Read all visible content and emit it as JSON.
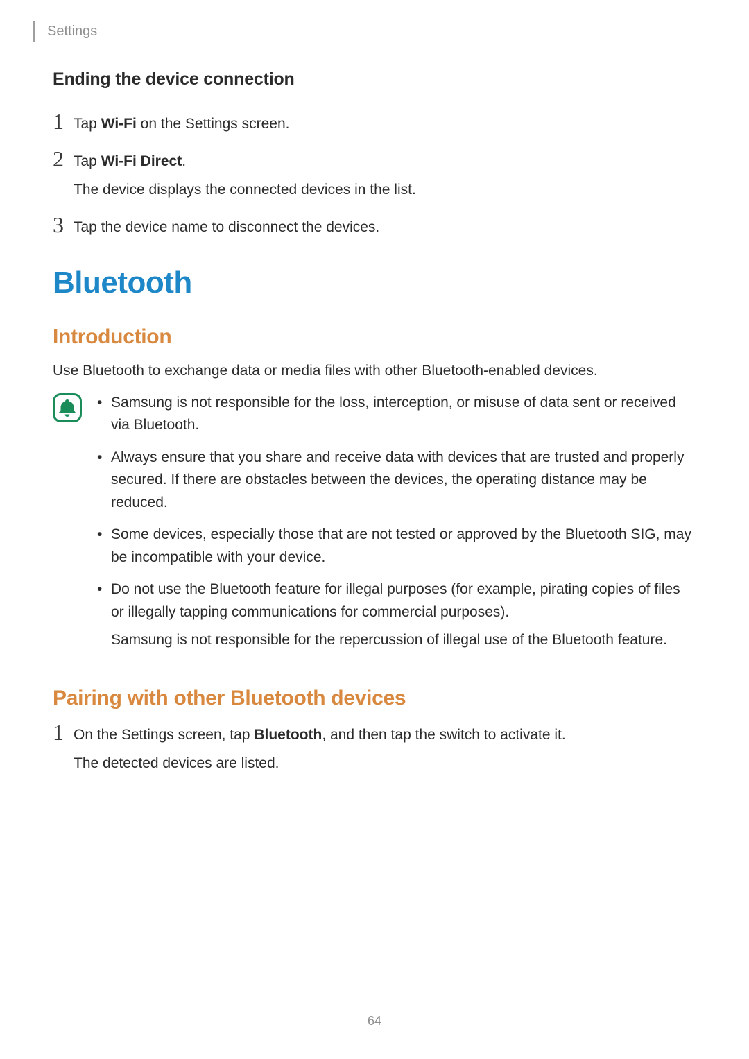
{
  "header": {
    "section": "Settings"
  },
  "sec1": {
    "heading": "Ending the device connection",
    "steps": [
      {
        "num": "1",
        "pre": "Tap ",
        "bold": "Wi-Fi",
        "post": " on the Settings screen."
      },
      {
        "num": "2",
        "pre": "Tap ",
        "bold": "Wi-Fi Direct",
        "post": ".",
        "sub": "The device displays the connected devices in the list."
      },
      {
        "num": "3",
        "pre": "Tap the device name to disconnect the devices.",
        "bold": "",
        "post": ""
      }
    ]
  },
  "sec2": {
    "title": "Bluetooth",
    "intro_h": "Introduction",
    "intro_p": "Use Bluetooth to exchange data or media files with other Bluetooth-enabled devices.",
    "notes": [
      {
        "text": "Samsung is not responsible for the loss, interception, or misuse of data sent or received via Bluetooth."
      },
      {
        "text": "Always ensure that you share and receive data with devices that are trusted and properly secured. If there are obstacles between the devices, the operating distance may be reduced."
      },
      {
        "text": "Some devices, especially those that are not tested or approved by the Bluetooth SIG, may be incompatible with your device."
      },
      {
        "text": "Do not use the Bluetooth feature for illegal purposes (for example, pirating copies of files or illegally tapping communications for commercial purposes).",
        "trail": "Samsung is not responsible for the repercussion of illegal use of the Bluetooth feature."
      }
    ]
  },
  "sec3": {
    "heading": "Pairing with other Bluetooth devices",
    "step1_num": "1",
    "step1_pre": "On the Settings screen, tap ",
    "step1_bold": "Bluetooth",
    "step1_post": ", and then tap the switch to activate it.",
    "step1_sub": "The detected devices are listed."
  },
  "page_number": "64"
}
